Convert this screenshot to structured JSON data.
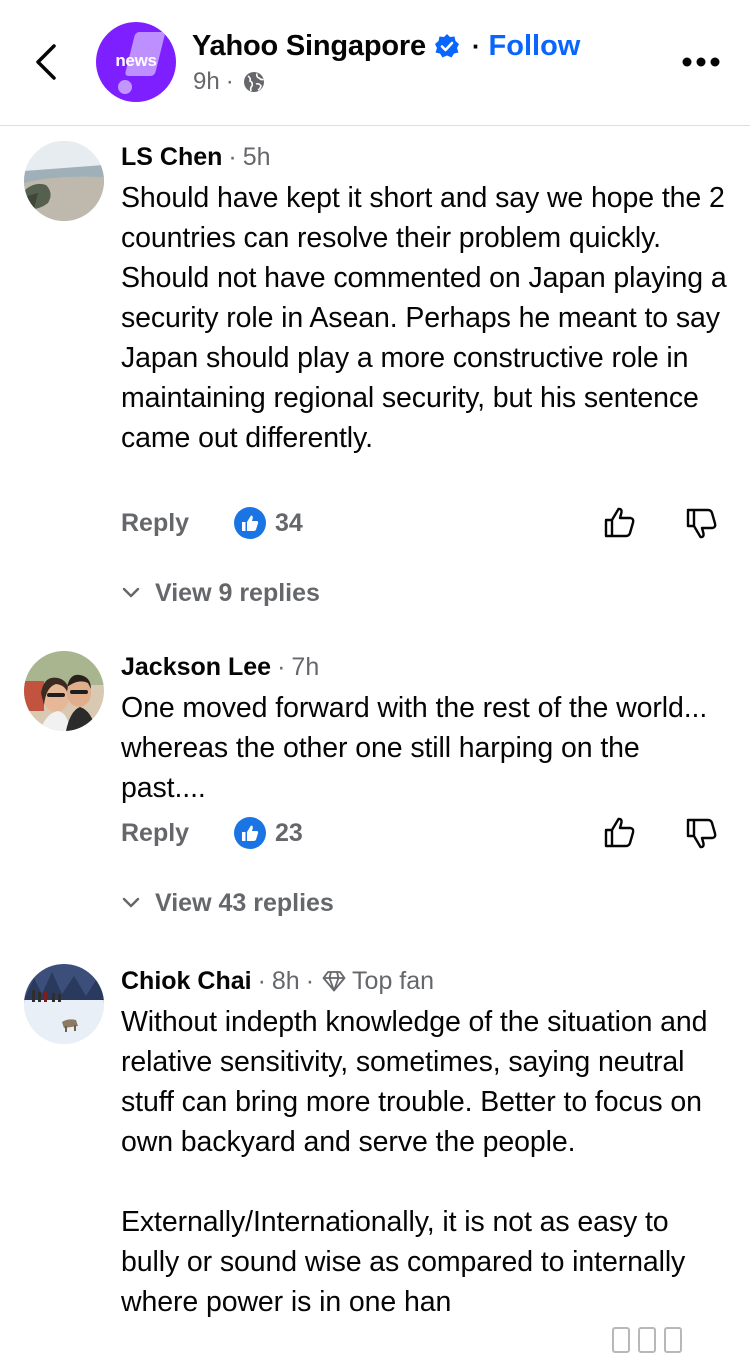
{
  "header": {
    "page_name": "Yahoo Singapore",
    "logo_text": "news",
    "separator": "·",
    "follow_label": "Follow",
    "post_time": "9h",
    "meta_separator": "·",
    "audience_icon": "globe-icon",
    "back_icon": "chevron-left-icon",
    "more_icon": "more-dots-icon",
    "verified_icon": "verified-badge-icon",
    "colors": {
      "brand": "#7e1fff",
      "follow": "#0866ff",
      "verified": "#0866ff"
    }
  },
  "comments": [
    {
      "author": "LS Chen",
      "separator": "·",
      "time": "5h",
      "badge": "",
      "text": "Should have kept it short and say we hope the 2 countries can resolve their problem quickly. Should not have commented on Japan playing a security role in Asean. Perhaps he meant to say Japan should play a more constructive role in maintaining regional security, but his sentence came out differently.",
      "reply_label": "Reply",
      "like_count": "34",
      "view_replies_label": "View 9 replies"
    },
    {
      "author": "Jackson Lee",
      "separator": "·",
      "time": "7h",
      "badge": "",
      "text": "One moved forward with the rest of the world... whereas the other one still harping on the past....",
      "reply_label": "Reply",
      "like_count": "23",
      "view_replies_label": "View 43 replies"
    },
    {
      "author": "Chiok Chai",
      "separator": "·",
      "time": "8h",
      "badge_separator": "·",
      "badge": "Top fan",
      "text": "Without indepth knowledge of the situation and relative sensitivity, sometimes, saying neutral stuff can bring more trouble. Better to focus on own backyard and serve the people.\n\nExternally/Internationally, it is not as easy to bully or sound wise as compared to internally where power is in one han",
      "reply_label": "",
      "like_count": "",
      "view_replies_label": ""
    }
  ],
  "icons": {
    "like_badge": "like-badge-icon",
    "thumb_up": "thumb-up-icon",
    "thumb_down": "thumb-down-icon",
    "chevron": "chevron-down-icon",
    "top_fan": "diamond-icon"
  }
}
